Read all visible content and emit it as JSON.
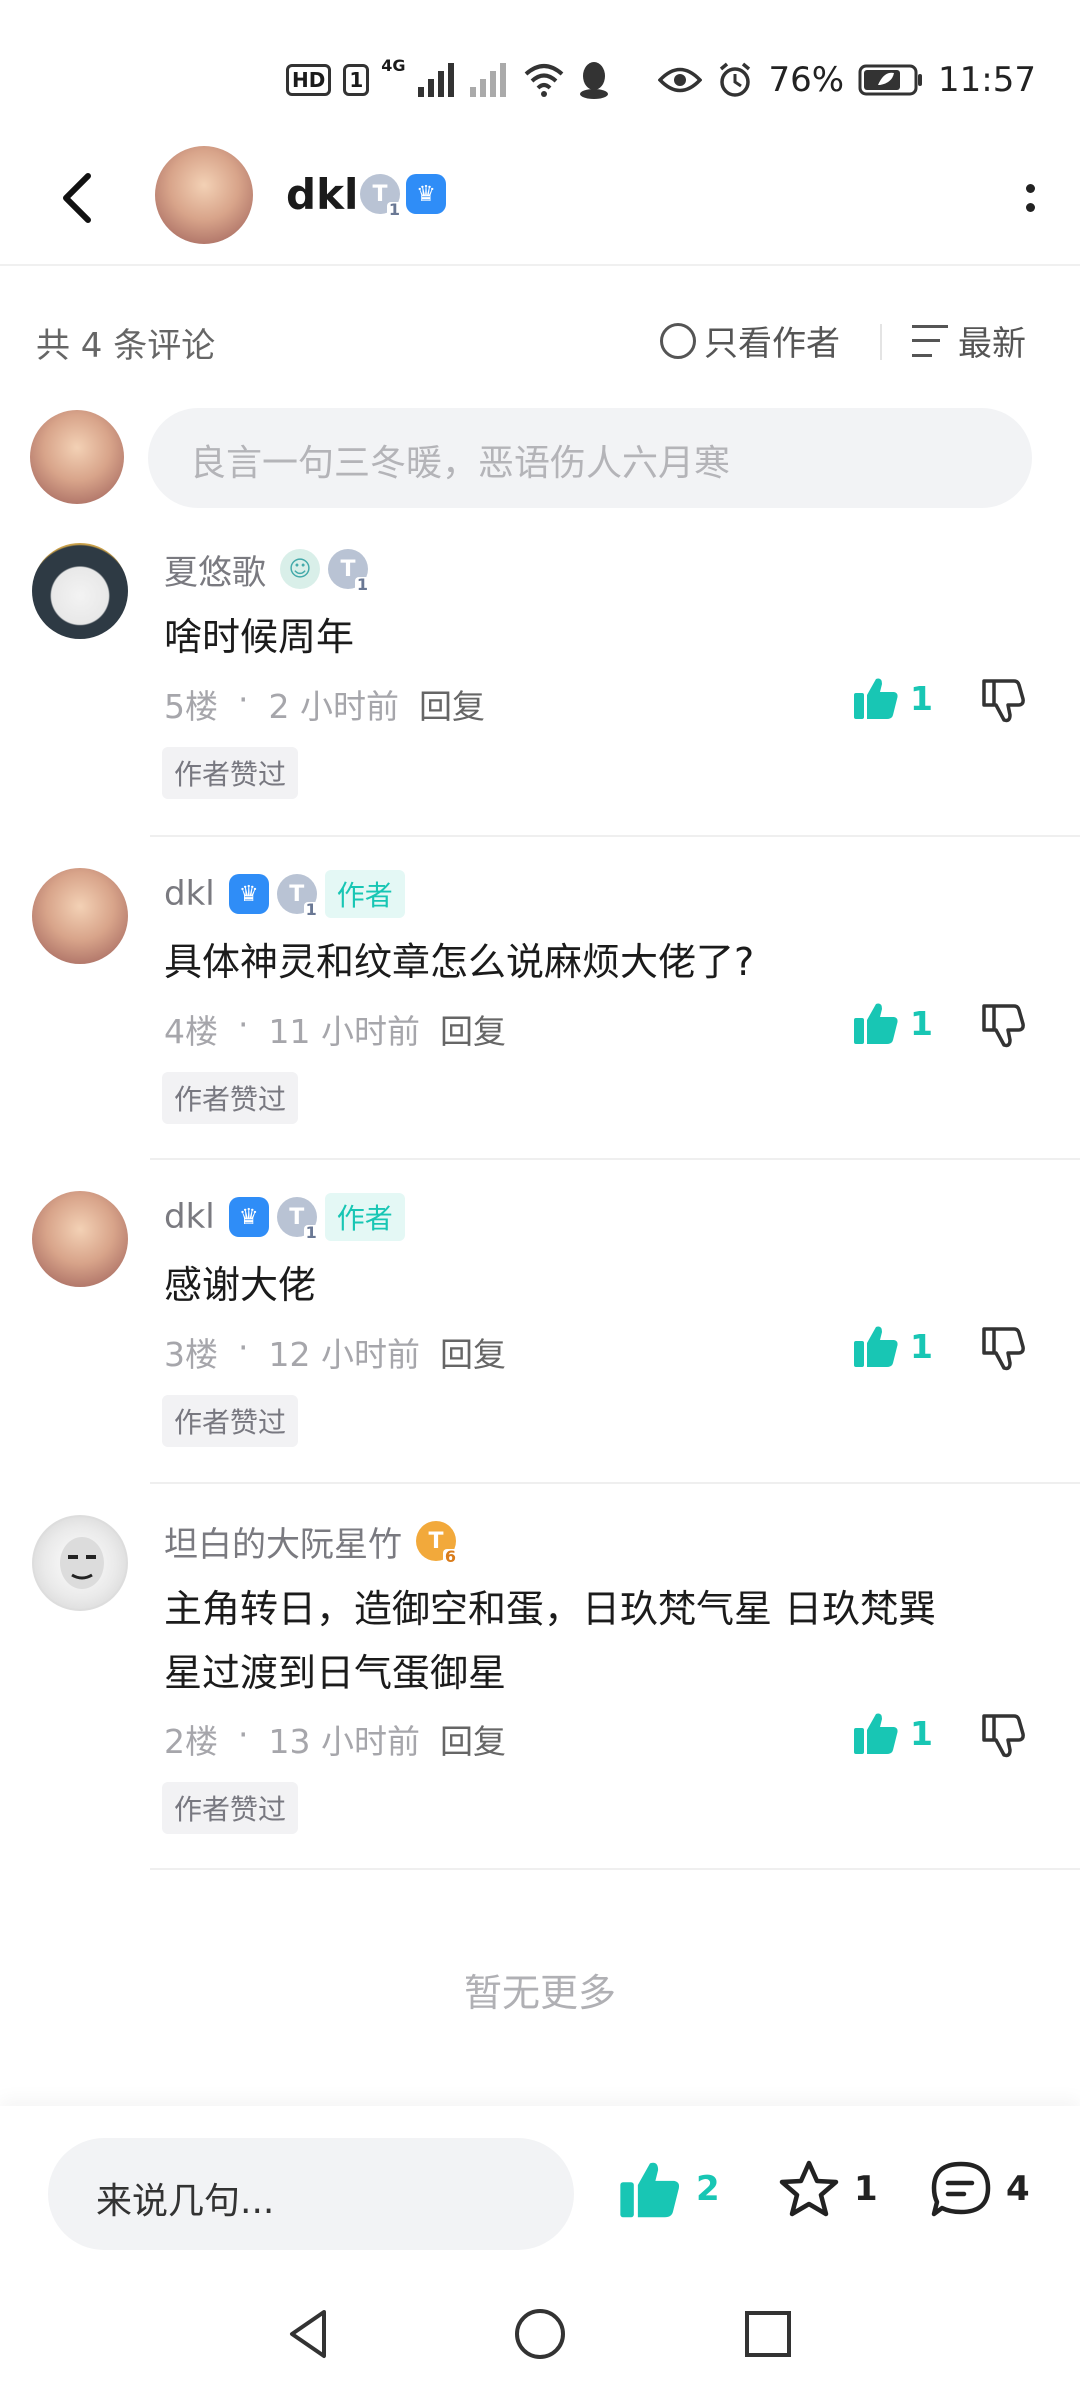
{
  "status_bar": {
    "hd_label": "HD",
    "sim_label": "1",
    "network_label": "4G",
    "battery_percent": "76%",
    "time": "11:57",
    "icons": [
      "hd-icon",
      "signal-icon",
      "signal-weak-icon",
      "wifi-icon",
      "qq-icon",
      "eye-icon",
      "alarm-icon",
      "battery-icon"
    ]
  },
  "header": {
    "username": "dkl",
    "badges": [
      "level-badge-icon",
      "trophy-badge-icon"
    ]
  },
  "sort": {
    "count_text": "共 4 条评论",
    "only_author_label": "只看作者",
    "latest_label": "最新"
  },
  "comment_input": {
    "placeholder": "良言一句三冬暖，恶语伤人六月寒"
  },
  "comments": [
    {
      "name": "夏悠歌",
      "is_author": false,
      "text": "啥时候周年",
      "floor": "5楼",
      "time": "2 小时前",
      "reply_label": "回复",
      "likes": "1",
      "praise_tag": "作者赞过"
    },
    {
      "name": "dkl",
      "is_author": true,
      "author_tag": "作者",
      "text": "具体神灵和纹章怎么说麻烦大佬了?",
      "floor": "4楼",
      "time": "11 小时前",
      "reply_label": "回复",
      "likes": "1",
      "praise_tag": "作者赞过"
    },
    {
      "name": "dkl",
      "is_author": true,
      "author_tag": "作者",
      "text": "感谢大佬",
      "floor": "3楼",
      "time": "12 小时前",
      "reply_label": "回复",
      "likes": "1",
      "praise_tag": "作者赞过"
    },
    {
      "name": "坦白的大阮星竹",
      "is_author": false,
      "badge_level": "6",
      "text_line1": "主角转日，造御空和蛋，日玖梵气星 日玖梵巽",
      "text_line2": "星过渡到日气蛋御星",
      "floor": "2楼",
      "time": "13 小时前",
      "reply_label": "回复",
      "likes": "1",
      "praise_tag": "作者赞过"
    }
  ],
  "footer_note": "暂无更多",
  "bottom_bar": {
    "say_placeholder": "来说几句...",
    "likes": "2",
    "stars": "1",
    "comments": "4"
  },
  "colors": {
    "accent": "#18c6b4",
    "author_tag_bg": "#e4f8f5",
    "input_bg": "#f2f3f5"
  }
}
